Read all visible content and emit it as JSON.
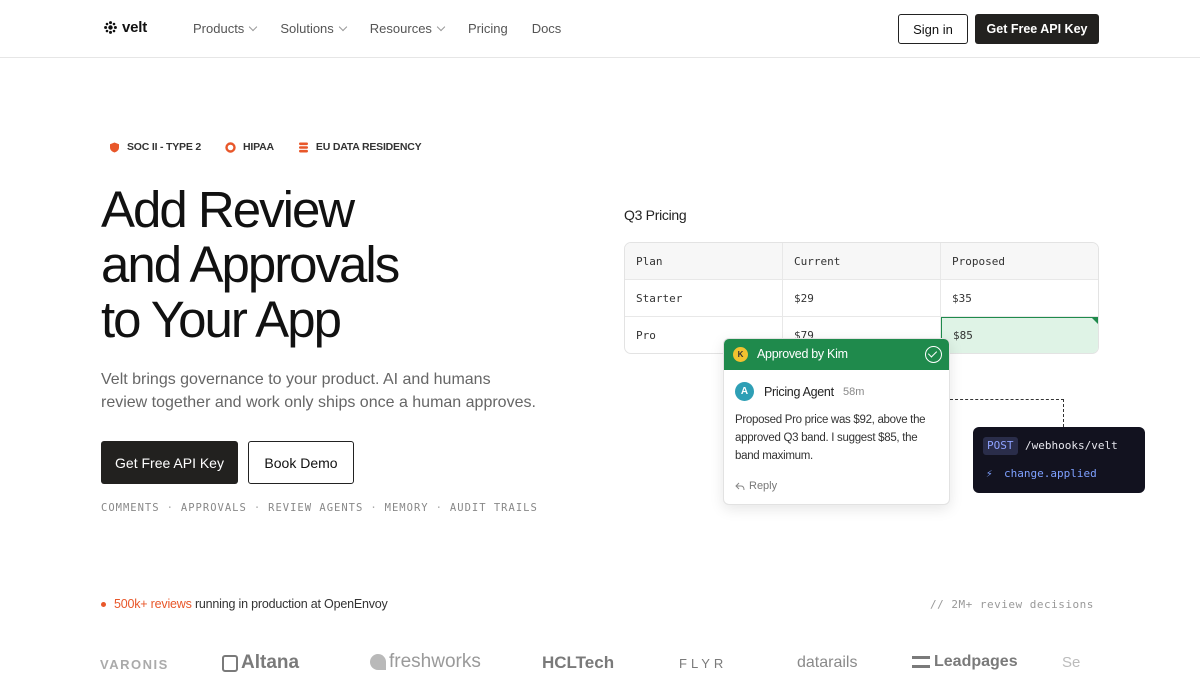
{
  "nav": {
    "brand": "velt",
    "links": [
      {
        "label": "Products",
        "dropdown": true
      },
      {
        "label": "Solutions",
        "dropdown": true
      },
      {
        "label": "Resources",
        "dropdown": true
      },
      {
        "label": "Pricing",
        "dropdown": false
      },
      {
        "label": "Docs",
        "dropdown": false
      }
    ],
    "sign_in": "Sign in",
    "api_key": "Get Free API Key"
  },
  "badges": [
    {
      "label": "SOC II - TYPE 2",
      "icon": "shield-icon",
      "color": "#e8572a"
    },
    {
      "label": "HIPAA",
      "icon": "ring-icon",
      "color": "#e8572a"
    },
    {
      "label": "EU DATA RESIDENCY",
      "icon": "database-icon",
      "color": "#e8572a"
    }
  ],
  "hero": {
    "title_lines": [
      "Add Review",
      "and Approvals",
      "to Your App"
    ],
    "subtitle": "Velt brings governance to your product. AI and humans review together and work only ships once a human approves.",
    "cta_primary": "Get Free API Key",
    "cta_secondary": "Book Demo",
    "features": [
      "COMMENTS",
      "APPROVALS",
      "REVIEW AGENTS",
      "MEMORY",
      "AUDIT TRAILS"
    ],
    "feature_separator": "·"
  },
  "pricing_card": {
    "title": "Q3 Pricing",
    "columns": [
      "Plan",
      "Current",
      "Proposed"
    ],
    "rows": [
      [
        "Starter",
        "$29",
        "$35"
      ],
      [
        "Pro",
        "$79",
        "$85"
      ]
    ]
  },
  "approval": {
    "avatar_initial": "K",
    "header": "Approved by Kim",
    "agent_initial": "A",
    "agent_name": "Pricing Agent",
    "time": "58m",
    "message": "Proposed Pro price was $92, above the approved Q3 band. I suggest $85, the band maximum.",
    "reply": "Reply",
    "accent": "#1f8a4c"
  },
  "webhook": {
    "method": "POST",
    "path": "/webhooks/velt",
    "event": "change.applied"
  },
  "social_proof": {
    "highlight": "500k+ reviews",
    "rest": "running in production at OpenEnvoy",
    "decisions": "// 2M+ review decisions",
    "accent": "#e8572a"
  },
  "logos": [
    "VARONIS",
    "Altana",
    "freshworks",
    "HCLTech",
    "FLYR",
    "datarails",
    "Leadpages",
    "Se"
  ]
}
